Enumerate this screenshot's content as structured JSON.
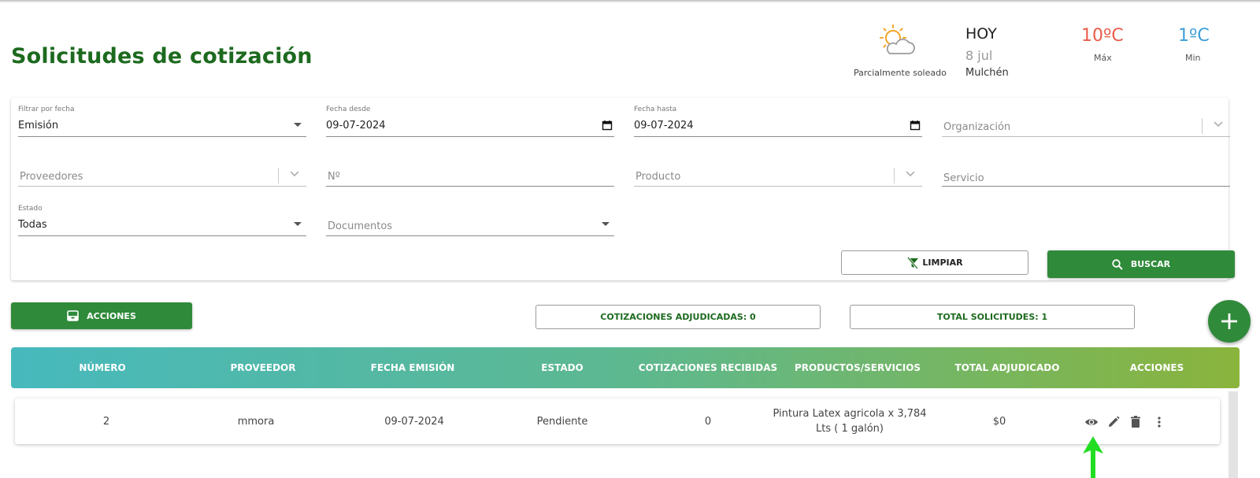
{
  "page": {
    "title": "Solicitudes de cotización"
  },
  "weather": {
    "condition": "Parcialmente soleado",
    "today": "HOY",
    "date": "8 jul",
    "city": "Mulchén",
    "max": "10ºC",
    "max_label": "Máx",
    "min": "1ºC",
    "min_label": "Min",
    "icon": "partly-sunny-icon"
  },
  "filters": {
    "filtrar_por_fecha": {
      "label": "Filtrar por fecha",
      "value": "Emisión"
    },
    "fecha_desde": {
      "label": "Fecha desde",
      "value": "09-07-2024"
    },
    "fecha_hasta": {
      "label": "Fecha hasta",
      "value": "09-07-2024"
    },
    "organizacion": {
      "placeholder": "Organización"
    },
    "proveedores": {
      "placeholder": "Proveedores"
    },
    "numero": {
      "placeholder": "Nº"
    },
    "producto": {
      "placeholder": "Producto"
    },
    "servicio": {
      "placeholder": "Servicio"
    },
    "estado": {
      "label": "Estado",
      "value": "Todas"
    },
    "documentos": {
      "placeholder": "Documentos"
    }
  },
  "buttons": {
    "limpiar": "LIMPIAR",
    "buscar": "BUSCAR",
    "acciones": "ACCIONES",
    "add": "+"
  },
  "summary": {
    "adjudicadas": "COTIZACIONES ADJUDICADAS: 0",
    "total": "TOTAL SOLICITUDES: 1"
  },
  "table": {
    "columns": [
      "NÚMERO",
      "PROVEEDOR",
      "FECHA EMISIÓN",
      "ESTADO",
      "COTIZACIONES RECIBIDAS",
      "PRODUCTOS/SERVICIOS",
      "TOTAL ADJUDICADO",
      "ACCIONES"
    ],
    "rows": [
      {
        "numero": "2",
        "proveedor": "mmora",
        "fecha": "09-07-2024",
        "estado": "Pendiente",
        "recibidas": "0",
        "productos_line1": "Pintura Latex agricola x 3,784",
        "productos_line2": "Lts ( 1 galón)",
        "total": "$0",
        "actions": [
          "eye-icon",
          "pencil-icon",
          "trash-icon",
          "more-vert-icon"
        ]
      }
    ]
  },
  "colors": {
    "brand_green": "#2f8a3a",
    "title_green": "#1d6a1f",
    "header_gradient": [
      "#47b9bd",
      "#8ab43c"
    ],
    "temp_max": "#ea5c4b",
    "temp_min": "#3d9fd8",
    "annotation_arrow": "#22dd22"
  }
}
